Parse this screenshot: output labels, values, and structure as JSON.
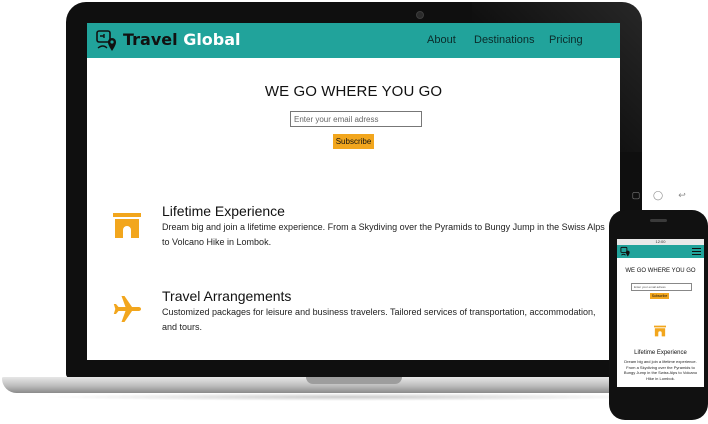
{
  "brand": {
    "part1": "Travel",
    "part2": "Global"
  },
  "nav": {
    "links": [
      {
        "label": "About"
      },
      {
        "label": "Destinations"
      },
      {
        "label": "Pricing"
      }
    ]
  },
  "hero": {
    "title": "WE GO WHERE YOU GO",
    "email_placeholder": "Enter your email adress",
    "subscribe_label": "Subscribe"
  },
  "features": [
    {
      "icon": "arch-icon",
      "title": "Lifetime Experience",
      "text": "Dream big and join a lifetime experience. From a Skydiving over the Pyramids to Bungy Jump in the Swiss Alps to Volcano Hike in Lombok."
    },
    {
      "icon": "airplane-icon",
      "title": "Travel Arrangements",
      "text": "Customized packages for leisure and business travelers. Tailored services of transportation, accommodation, and tours."
    }
  ],
  "phone": {
    "status_time": "12:00",
    "hw_buttons": [
      "▢",
      "◯",
      "↩"
    ]
  },
  "colors": {
    "nav_bg": "#21a39b",
    "accent": "#f2a61d"
  }
}
